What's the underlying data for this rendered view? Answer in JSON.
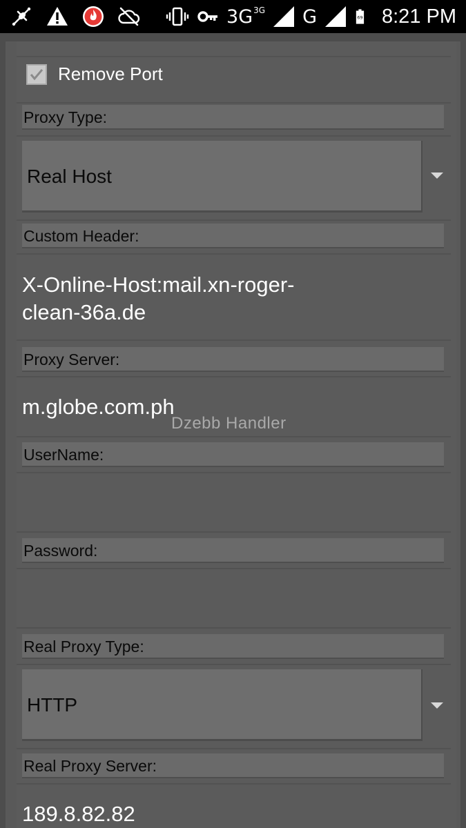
{
  "status_bar": {
    "icons_left": [
      "usb-debug-icon",
      "warning-icon",
      "app-notification-icon",
      "cloud-off-icon"
    ],
    "icons_right": [
      "vibrate-icon",
      "vpn-key-icon",
      "signal-icon",
      "battery-icon"
    ],
    "network_primary": "3G",
    "network_primary_sup": "3G",
    "network_secondary": "G",
    "battery_level": "69",
    "time": "8:21 PM"
  },
  "form": {
    "remove_port": {
      "label": "Remove Port",
      "checked": true
    },
    "proxy_type": {
      "label": "Proxy Type:",
      "value": "Real Host"
    },
    "custom_header": {
      "label": "Custom Header:",
      "value": "X-Online-Host:mail.xn-roger-clean-36a.de",
      "line1": "X-Online-Host:mail.xn-roger-",
      "line2": "clean-36a.de"
    },
    "proxy_server": {
      "label": "Proxy Server:",
      "value": "m.globe.com.ph"
    },
    "username": {
      "label": "UserName:",
      "value": ""
    },
    "password": {
      "label": "Password:",
      "value": ""
    },
    "real_proxy_type": {
      "label": "Real Proxy Type:",
      "value": "HTTP"
    },
    "real_proxy_server": {
      "label": "Real Proxy Server:",
      "value": "189.8.82.82"
    }
  },
  "watermark": "Dzebb  Handler",
  "colors": {
    "status_bar_bg": "#000000",
    "panel_bg": "#5b5b5b",
    "label_bar_bg": "#6a6a6a",
    "spinner_bg": "#6e6e6e",
    "text_light": "#ffffff",
    "text_dark": "#0a0a0a",
    "app_icon_red": "#e53935"
  }
}
